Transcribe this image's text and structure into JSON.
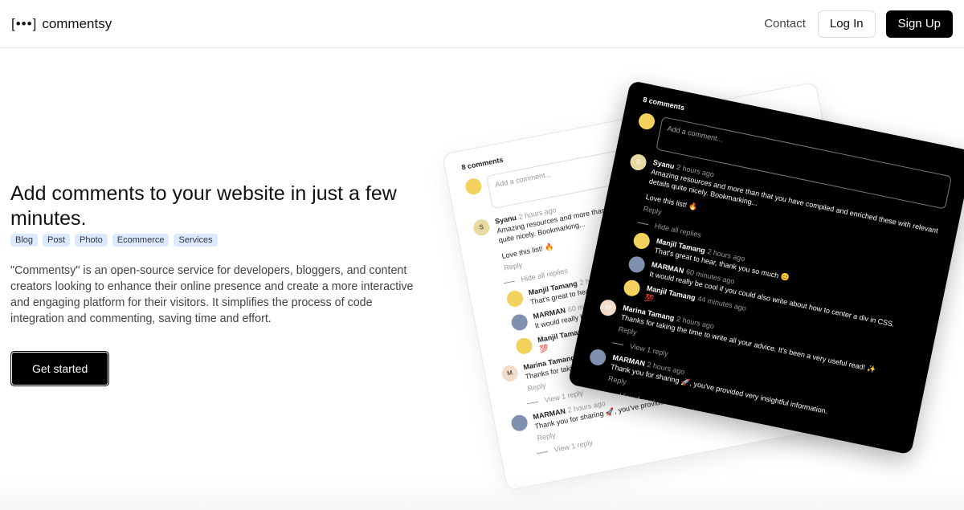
{
  "nav": {
    "logo_mark": "[•••]",
    "logo_text": "commentsy",
    "contact": "Contact",
    "login": "Log In",
    "signup": "Sign Up"
  },
  "hero": {
    "title": "Add comments to your website in just a few minutes.",
    "tags": [
      "Blog",
      "Post",
      "Photo",
      "Ecommerce",
      "Services"
    ],
    "description": "\"Commentsy\" is an open-source service for developers, bloggers, and content creators looking to enhance their online presence and create a more interactive and engaging platform for their visitors. It simplifies the process of code integration and commenting, saving time and effort.",
    "cta": "Get started"
  },
  "widget": {
    "count": "8 comments",
    "placeholder": "Add a comment...",
    "reply": "Reply",
    "hide_replies": "Hide all replies",
    "view_reply": "View 1 reply",
    "comments": [
      {
        "author": "Syanu",
        "time": "2 hours ago",
        "text": "Amazing resources and more than that you have compiled and enriched these with relevant details quite nicely. Bookmarking...",
        "extra": "Love this list! 🔥",
        "avatar": "S",
        "color": "#e8d9a0",
        "replies": [
          {
            "author": "Manjil Tamang",
            "time": "2 hours ago",
            "text": "That's great to hear, thank you so much 😊",
            "color": "#f2d15c"
          },
          {
            "author": "MARMAN",
            "time": "60 minutes ago",
            "text": "It would really be cool if you could also write about how to center a div in CSS.",
            "color": "#8090b0"
          },
          {
            "author": "Manjil Tamang",
            "time": "44 minutes ago",
            "text": "💯",
            "color": "#f2d15c"
          }
        ]
      },
      {
        "author": "Marina Tamang",
        "time": "2 hours ago",
        "text": "Thanks for taking the time to write all your advice. It's been a very useful read! ✨",
        "avatar": "M",
        "color": "#f3dccb",
        "replies": []
      },
      {
        "author": "MARMAN",
        "time": "2 hours ago",
        "text": "Thank you for sharing 🚀, you've provided very insightful information.",
        "color": "#8090b0",
        "replies": []
      }
    ]
  }
}
